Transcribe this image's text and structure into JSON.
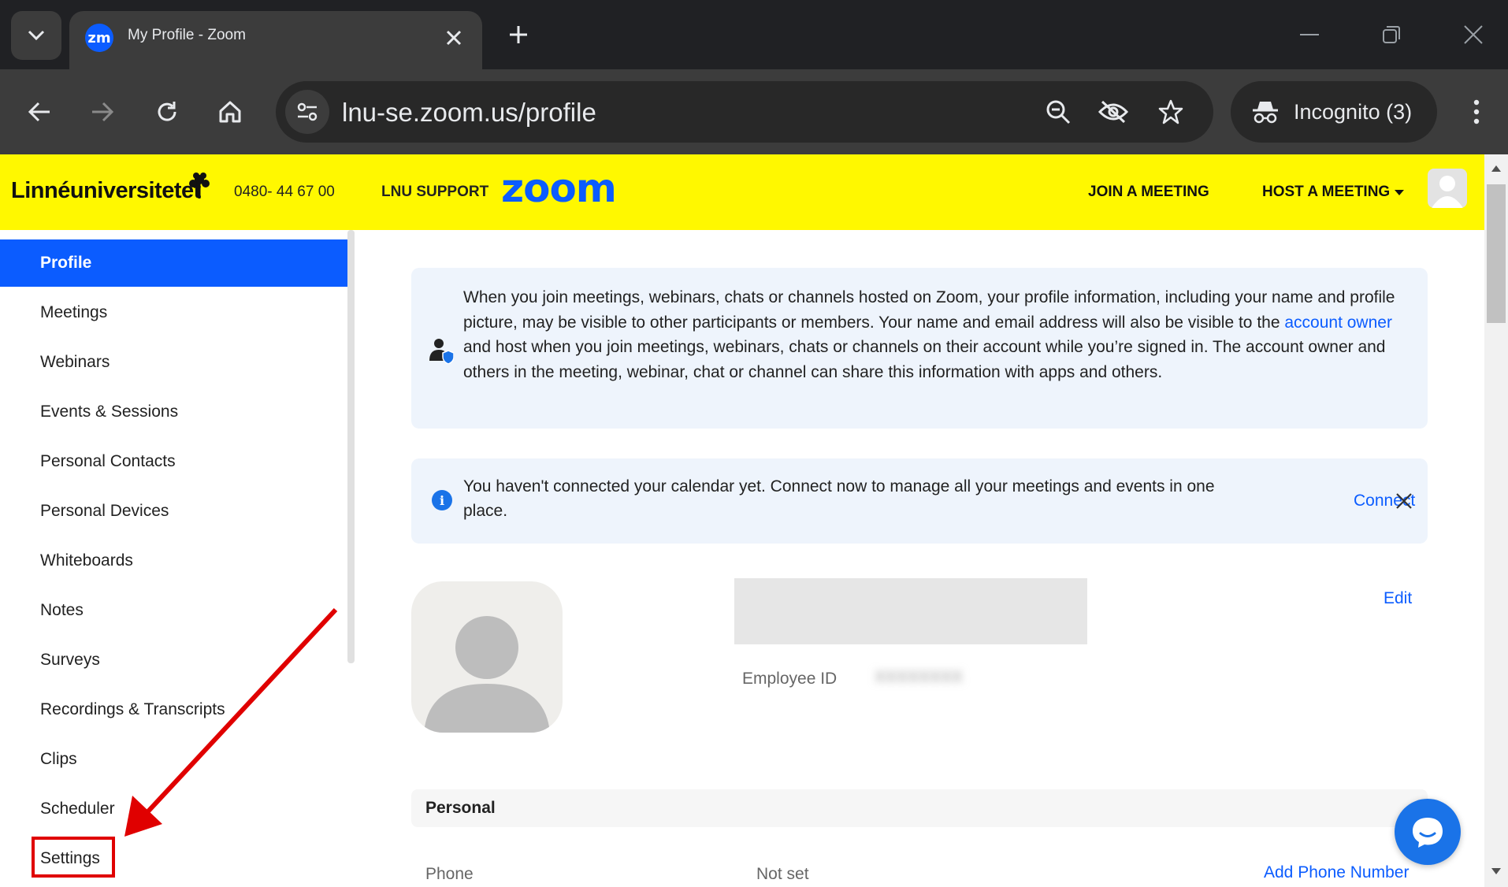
{
  "browser": {
    "tab_title": "My Profile - Zoom",
    "favicon_text": "zm",
    "url": "lnu-se.zoom.us/profile",
    "incognito_label": "Incognito (3)"
  },
  "header": {
    "university": "Linnéuniversitetet",
    "phone": "0480- 44 67 00",
    "support": "LNU SUPPORT",
    "logo": "zoom",
    "join_meeting": "JOIN A MEETING",
    "host_meeting": "HOST A MEETING"
  },
  "sidebar": {
    "items": [
      {
        "label": "Profile",
        "active": true
      },
      {
        "label": "Meetings"
      },
      {
        "label": "Webinars"
      },
      {
        "label": "Events & Sessions"
      },
      {
        "label": "Personal Contacts"
      },
      {
        "label": "Personal Devices"
      },
      {
        "label": "Whiteboards"
      },
      {
        "label": "Notes"
      },
      {
        "label": "Surveys"
      },
      {
        "label": "Recordings & Transcripts"
      },
      {
        "label": "Clips"
      },
      {
        "label": "Scheduler"
      },
      {
        "label": "Settings"
      }
    ]
  },
  "privacy": {
    "text_before": "When you join meetings, webinars, chats or channels hosted on Zoom, your profile information, including your name and profile picture, may be visible to other participants or members. Your name and email address will also be visible to the ",
    "link": "account owner",
    "text_after": " and host when you join meetings, webinars, chats or channels on their account while you’re signed in. The account owner and others in the meeting, webinar, chat or channel can share this information with apps and others."
  },
  "calendar": {
    "text": "You haven't connected your calendar yet. Connect now to manage all your meetings and events in one place.",
    "connect": "Connect"
  },
  "profile": {
    "employee_id_label": "Employee ID",
    "employee_id_value": "XXXXXXXX",
    "edit": "Edit",
    "personal_section": "Personal",
    "phone_label": "Phone",
    "phone_value": "Not set",
    "add_phone": "Add Phone Number"
  },
  "colors": {
    "accent": "#0b5cff",
    "header_bg": "#fff800",
    "annotation": "#e00000"
  }
}
